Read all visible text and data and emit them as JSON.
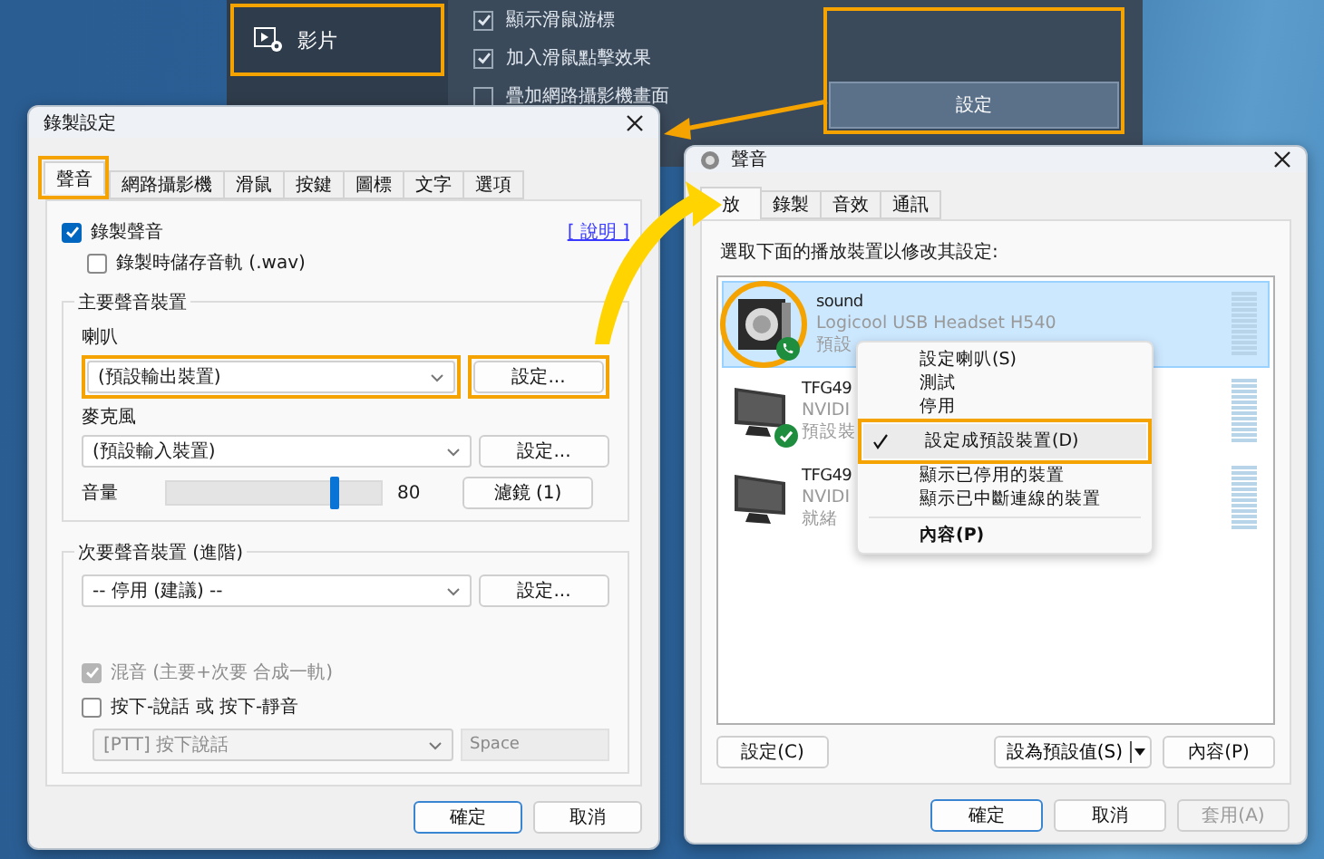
{
  "background_app": {
    "sidebar_item": {
      "label": "影片",
      "annotated": true
    },
    "options": [
      {
        "label": "顯示滑鼠游標",
        "checked": true
      },
      {
        "label": "加入滑鼠點擊效果",
        "checked": true
      },
      {
        "label": "疊加網路攝影機畫面",
        "checked": false
      }
    ],
    "settings_button": {
      "label": "設定",
      "annotated": true
    }
  },
  "recording_dialog": {
    "title": "錄製設定",
    "tabs": [
      {
        "label": "聲音",
        "selected": true,
        "annotated": true
      },
      {
        "label": "網路攝影機",
        "selected": false,
        "annotated": false
      },
      {
        "label": "滑鼠",
        "selected": false,
        "annotated": false
      },
      {
        "label": "按鍵",
        "selected": false,
        "annotated": false
      },
      {
        "label": "圖標",
        "selected": false,
        "annotated": false
      },
      {
        "label": "文字",
        "selected": false,
        "annotated": false
      },
      {
        "label": "選項",
        "selected": false,
        "annotated": false
      }
    ],
    "record_sound": {
      "label": "錄製聲音",
      "checked": true
    },
    "help_link": "[ 說明 ]",
    "save_track": {
      "label": "錄製時儲存音軌 (.wav)",
      "checked": false
    },
    "primary_group": {
      "title": "主要聲音裝置",
      "speaker": {
        "label": "喇叭",
        "value": "(預設輸出裝置)",
        "annotated": true,
        "button": "設定...",
        "button_annotated": true
      },
      "microphone": {
        "label": "麥克風",
        "value": "(預設輸入裝置)",
        "annotated": false,
        "button": "設定...",
        "button_annotated": false
      },
      "volume": {
        "label": "音量",
        "level": 0.78,
        "reading": "80",
        "button": "濾鏡 (1)"
      }
    },
    "secondary_group": {
      "title": "次要聲音裝置 (進階)",
      "device": {
        "value": "-- 停用 (建議) --",
        "button": "設定..."
      },
      "mix": {
        "label": "混音 (主要+次要 合成一軌)",
        "checked": true,
        "disabled": true
      },
      "push_to_talk": {
        "label": "按下-說話 或 按下-靜音",
        "checked": false,
        "disabled": false
      },
      "ptt_mode": {
        "value": "[PTT] 按下說話",
        "disabled": true
      },
      "hotkey": {
        "value": "Space",
        "disabled": true
      }
    },
    "buttons": [
      {
        "label": "確定",
        "default": true,
        "disabled": false
      },
      {
        "label": "取消",
        "default": false,
        "disabled": false
      }
    ]
  },
  "sound_dialog": {
    "title": "聲音",
    "tabs": [
      {
        "label": "放",
        "selected": true
      },
      {
        "label": "錄製",
        "selected": false
      },
      {
        "label": "音效",
        "selected": false
      },
      {
        "label": "通訊",
        "selected": false
      }
    ],
    "instruction": "選取下面的播放裝置以修改其設定:",
    "devices": [
      {
        "name": "sound",
        "detail": "Logicool USB Headset H540",
        "status": "預設",
        "kind": "headset_communication",
        "selected": true,
        "annotated": true
      },
      {
        "name": "TFG49",
        "detail": "NVIDI",
        "status": "預設裝",
        "kind": "monitor_default",
        "selected": false,
        "annotated": false
      },
      {
        "name": "TFG49",
        "detail": "NVIDI",
        "status": "就緒",
        "kind": "monitor",
        "selected": false,
        "annotated": false
      }
    ],
    "context_menu": [
      {
        "kind": "item",
        "label": "設定喇叭(S)",
        "checked": false,
        "default": false,
        "annotated": false
      },
      {
        "kind": "item",
        "label": "測試",
        "checked": false,
        "default": false,
        "annotated": false
      },
      {
        "kind": "item",
        "label": "停用",
        "checked": false,
        "default": false,
        "annotated": false
      },
      {
        "kind": "item",
        "label": "設定成預設裝置(D)",
        "checked": true,
        "default": false,
        "annotated": true
      },
      {
        "kind": "item",
        "label": "顯示已停用的裝置",
        "checked": false,
        "default": false,
        "annotated": false
      },
      {
        "kind": "item",
        "label": "顯示已中斷連線的裝置",
        "checked": false,
        "default": false,
        "annotated": false
      },
      {
        "kind": "separator"
      },
      {
        "kind": "item",
        "label": "內容(P)",
        "checked": false,
        "default": true,
        "annotated": false
      }
    ],
    "action_buttons": [
      {
        "label": "設定(C)",
        "kind": "plain"
      },
      {
        "label": "設為預設值(S)",
        "kind": "split"
      },
      {
        "label": "內容(P)",
        "kind": "plain"
      }
    ],
    "buttons": [
      {
        "label": "確定",
        "default": true,
        "disabled": false
      },
      {
        "label": "取消",
        "default": false,
        "disabled": false
      },
      {
        "label": "套用(A)",
        "default": false,
        "disabled": true
      }
    ]
  }
}
